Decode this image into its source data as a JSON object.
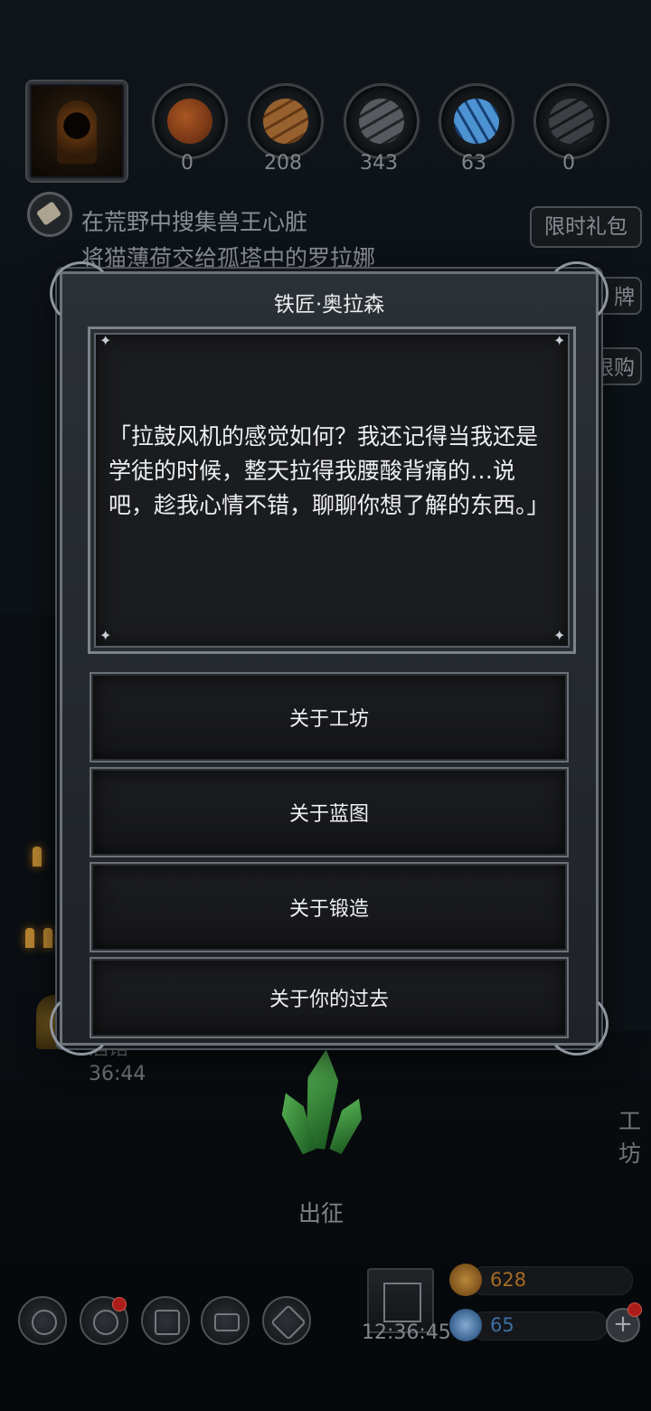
{
  "hud": {
    "resources": [
      {
        "name": "meat",
        "icon": "meat-icon",
        "count": "0",
        "color": "#b4561f"
      },
      {
        "name": "wood",
        "icon": "wood-plank-icon",
        "count": "208",
        "color": "#a5652c"
      },
      {
        "name": "iron",
        "icon": "iron-ingot-icon",
        "count": "343",
        "color": "#55595e"
      },
      {
        "name": "crystal",
        "icon": "blue-crystal-icon",
        "count": "63",
        "color": "#3d86d6"
      },
      {
        "name": "steel",
        "icon": "steel-bar-icon",
        "count": "0",
        "color": "#3c4045"
      }
    ],
    "quests": [
      "在荒野中搜集兽王心脏",
      "将猫薄荷交给孤塔中的罗拉娜"
    ],
    "side_buttons": [
      "限时礼包",
      "牌",
      "限购"
    ]
  },
  "dialog": {
    "npc_name": "铁匠·奥拉森",
    "speech": "「拉鼓风机的感觉如何？我还记得当我还是学徒的时候，整天拉得我腰酸背痛的…说吧，趁我心情不错，聊聊你想了解的东西。」",
    "options": [
      "关于工坊",
      "关于蓝图",
      "关于锻造",
      "关于你的过去"
    ]
  },
  "scene": {
    "tavern_label": "酒馆",
    "tavern_timer": "36:44",
    "expedition_label": "出征",
    "workshop_label": "工坊"
  },
  "bottom_bar": {
    "icons": [
      "settings-icon",
      "achievement-icon",
      "heroes-icon",
      "mail-icon",
      "forge-icon"
    ],
    "gift_timer": "12:36:45",
    "gold": "628",
    "gems": "65",
    "gold_color": "#c8832a",
    "gem_color": "#4a88c7"
  }
}
